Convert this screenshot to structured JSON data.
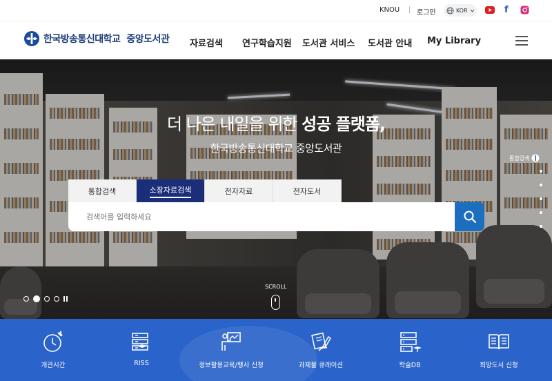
{
  "topbar": {
    "knou": "KNOU",
    "separator": "|",
    "login": "로그인",
    "lang": "KOR"
  },
  "nav": {
    "logo_university": "한국방송통신대학교",
    "logo_library": "중앙도서관",
    "menu": [
      "자료검색",
      "연구학습지원",
      "도서관 서비스",
      "도서관 안내",
      "My Library"
    ]
  },
  "hero": {
    "title_plain": "더 나은 내일을 위한 ",
    "title_bold": "성공 플랫폼,",
    "subtitle": "한국방송통신대학교 중앙도서관",
    "tabs": [
      "통합검색",
      "소장자료검색",
      "전자자료",
      "전자도서"
    ],
    "active_tab": 1,
    "search_placeholder": "검색어를 입력하세요",
    "side_label": "통합검색",
    "scroll_label": "SCROLL"
  },
  "quick_menu": [
    {
      "label": "개관시간",
      "icon": "clock-icon"
    },
    {
      "label": "RISS",
      "icon": "database-icon"
    },
    {
      "label": "정보활용교육/행사 신청",
      "icon": "presentation-icon"
    },
    {
      "label": "과제물 큐레이션",
      "icon": "writing-hand-icon"
    },
    {
      "label": "학술DB",
      "icon": "server-icon"
    },
    {
      "label": "희망도서 신청",
      "icon": "open-book-icon"
    }
  ],
  "colors": {
    "brand_navy": "#1b2e7a",
    "search_blue": "#1c6fbf",
    "quick_menu_blue": "#2a63c9",
    "youtube_red": "#e02020"
  }
}
